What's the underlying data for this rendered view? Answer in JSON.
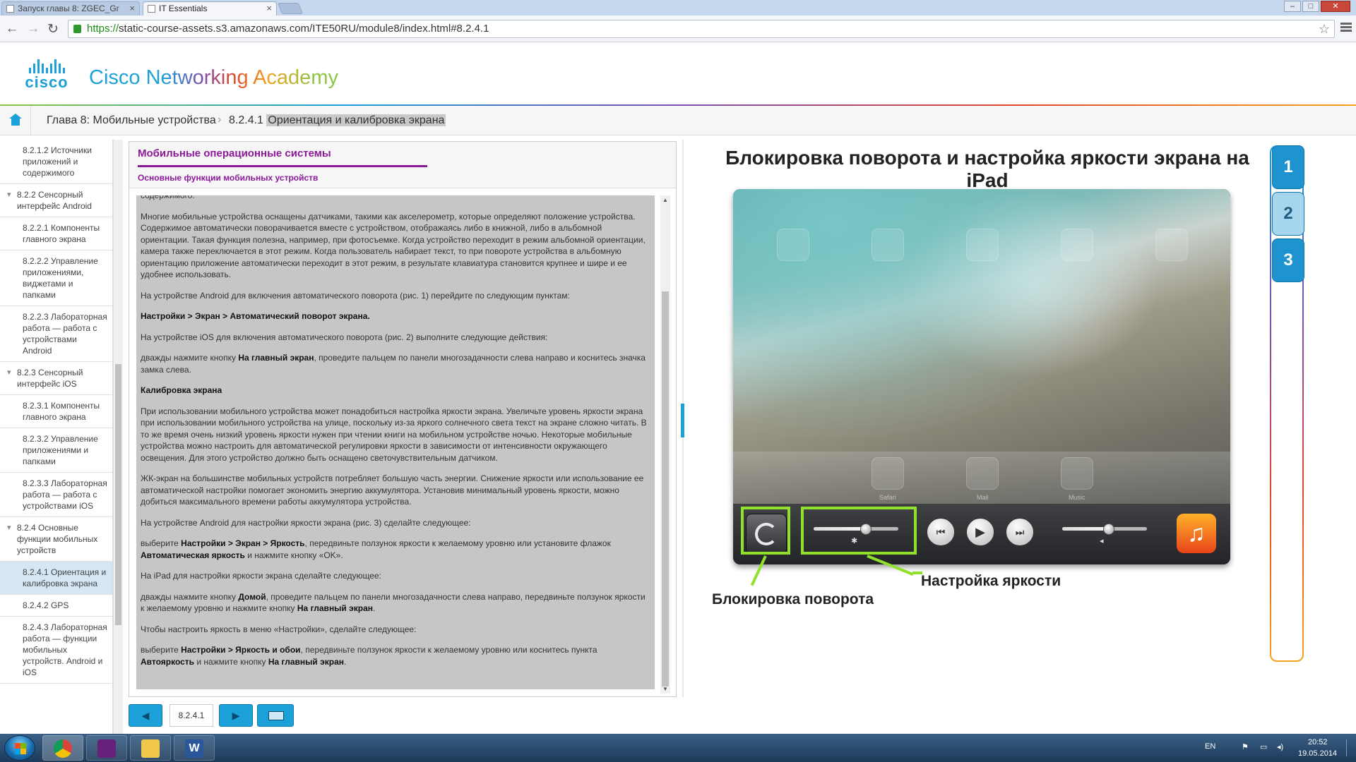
{
  "browser": {
    "tabs": [
      {
        "title": "Запуск главы 8: ZGEC_Gr",
        "active": false
      },
      {
        "title": "IT Essentials",
        "active": true
      }
    ],
    "url_scheme": "https://",
    "url_rest": "static-course-assets.s3.amazonaws.com/ITE50RU/module8/index.html#8.2.4.1"
  },
  "header": {
    "logo_word": "cisco",
    "title": "Cisco Networking Academy"
  },
  "breadcrumb": {
    "chapter": "Глава 8: Мобильные устройства",
    "current": "8.2.4.1 Ориентация и калибровка экрана",
    "current_num": "8.2.4.1",
    "current_title": "Ориентация и калибровка экрана"
  },
  "toc": [
    {
      "label": "8.2.1.2 Источники приложений и содержимого",
      "type": "item"
    },
    {
      "label": "8.2.2 Сенсорный интерфейс Android",
      "type": "section"
    },
    {
      "label": "8.2.2.1 Компоненты главного экрана",
      "type": "item"
    },
    {
      "label": "8.2.2.2 Управление приложениями, виджетами и папками",
      "type": "item"
    },
    {
      "label": "8.2.2.3 Лабораторная работа — работа с устройствами Android",
      "type": "item"
    },
    {
      "label": "8.2.3 Сенсорный интерфейс iOS",
      "type": "section"
    },
    {
      "label": "8.2.3.1 Компоненты главного экрана",
      "type": "item"
    },
    {
      "label": "8.2.3.2 Управление приложениями и папками",
      "type": "item"
    },
    {
      "label": "8.2.3.3 Лабораторная работа — работа с устройствами iOS",
      "type": "item"
    },
    {
      "label": "8.2.4 Основные функции мобильных устройств",
      "type": "section"
    },
    {
      "label": "8.2.4.1 Ориентация и калибровка экрана",
      "type": "item",
      "selected": true
    },
    {
      "label": "8.2.4.2 GPS",
      "type": "item"
    },
    {
      "label": "8.2.4.3 Лабораторная работа — функции мобильных устройств. Android и iOS",
      "type": "item"
    }
  ],
  "content": {
    "title": "Мобильные операционные системы",
    "subtitle": "Основные функции мобильных устройств",
    "cut_line": "содержимого.",
    "p1": "Многие мобильные устройства оснащены датчиками, такими как акселерометр, которые определяют положение устройства. Содержимое автоматически поворачивается вместе с устройством, отображаясь либо в книжной, либо в альбомной ориентации. Такая функция полезна, например, при фотосъемке. Когда устройство переходит в режим альбомной ориентации, камера также переключается в этот режим. Когда пользователь набирает текст, то при повороте устройства в альбомную ориентацию приложение автоматически переходит в этот режим, в результате клавиатура становится крупнее и шире и ее удобнее использовать.",
    "p2": "На устройстве Android для включения автоматического поворота (рис. 1) перейдите по следующим пунктам:",
    "p3": "Настройки > Экран > Автоматический поворот экрана.",
    "p4": "На устройстве iOS для включения автоматического поворота (рис. 2) выполните следующие действия:",
    "p5a": "дважды нажмите кнопку ",
    "p5b": "На главный экран",
    "p5c": ", проведите пальцем по панели многозадачности слева направо и коснитесь значка замка слева.",
    "p6": "Калибровка экрана",
    "p7": "При использовании мобильного устройства может понадобиться настройка яркости экрана. Увеличьте уровень яркости экрана при использовании мобильного устройства на улице, поскольку из-за яркого солнечного света текст на экране сложно читать. В то же время очень низкий уровень яркости нужен при чтении книги на мобильном устройстве ночью. Некоторые мобильные устройства можно настроить для автоматической регулировки яркости в зависимости от интенсивности окружающего освещения. Для этого устройство должно быть оснащено светочувствительным датчиком.",
    "p8": "ЖК-экран на большинстве мобильных устройств потребляет большую часть энергии. Снижение яркости или использование ее автоматической настройки помогает экономить энергию аккумулятора. Установив минимальный уровень яркости, можно добиться максимального времени работы аккумулятора устройства.",
    "p9": "На устройстве Android для настройки яркости экрана (рис. 3) сделайте следующее:",
    "p10a": "выберите ",
    "p10b": "Настройки > Экран > Яркость",
    "p10c": ", передвиньте ползунок яркости к желаемому уровню или установите флажок ",
    "p10d": "Автоматическая яркость",
    "p10e": " и нажмите кнопку «OK».",
    "p11": "На iPad для настройки яркости экрана сделайте следующее:",
    "p12a": "дважды нажмите кнопку ",
    "p12b": "Домой",
    "p12c": ", проведите пальцем по панели многозадачности слева направо, передвиньте ползунок яркости к желаемому уровню и нажмите кнопку ",
    "p12d": "На главный экран",
    "p12e": ".",
    "p13": "Чтобы настроить яркость в меню «Настройки», сделайте следующее:",
    "p14a": "выберите ",
    "p14b": "Настройки > Яркость и обои",
    "p14c": ", передвиньте ползунок яркости к желаемому уровню или коснитесь пункта ",
    "p14d": "Автояркость",
    "p14e": " и нажмите кнопку ",
    "p14f": "На главный экран",
    "p14g": "."
  },
  "pager": {
    "page": "8.2.4.1"
  },
  "figure": {
    "title": "Блокировка поворота и настройка яркости экрана на iPad",
    "label_lock": "Блокировка поворота",
    "label_brightness": "Настройка яркости",
    "dock_apps": [
      "Safari",
      "Mail",
      "Music"
    ],
    "brightness_level": 0.62,
    "volume_level": 0.55,
    "tabs": [
      "1",
      "2",
      "3"
    ],
    "active_tab": "2"
  },
  "taskbar": {
    "lang": "EN",
    "time": "20:52",
    "date": "19.05.2014"
  },
  "colors": {
    "brand": "#1ba0d7",
    "heading": "#8b1a99",
    "highlight": "#8fe12c"
  }
}
